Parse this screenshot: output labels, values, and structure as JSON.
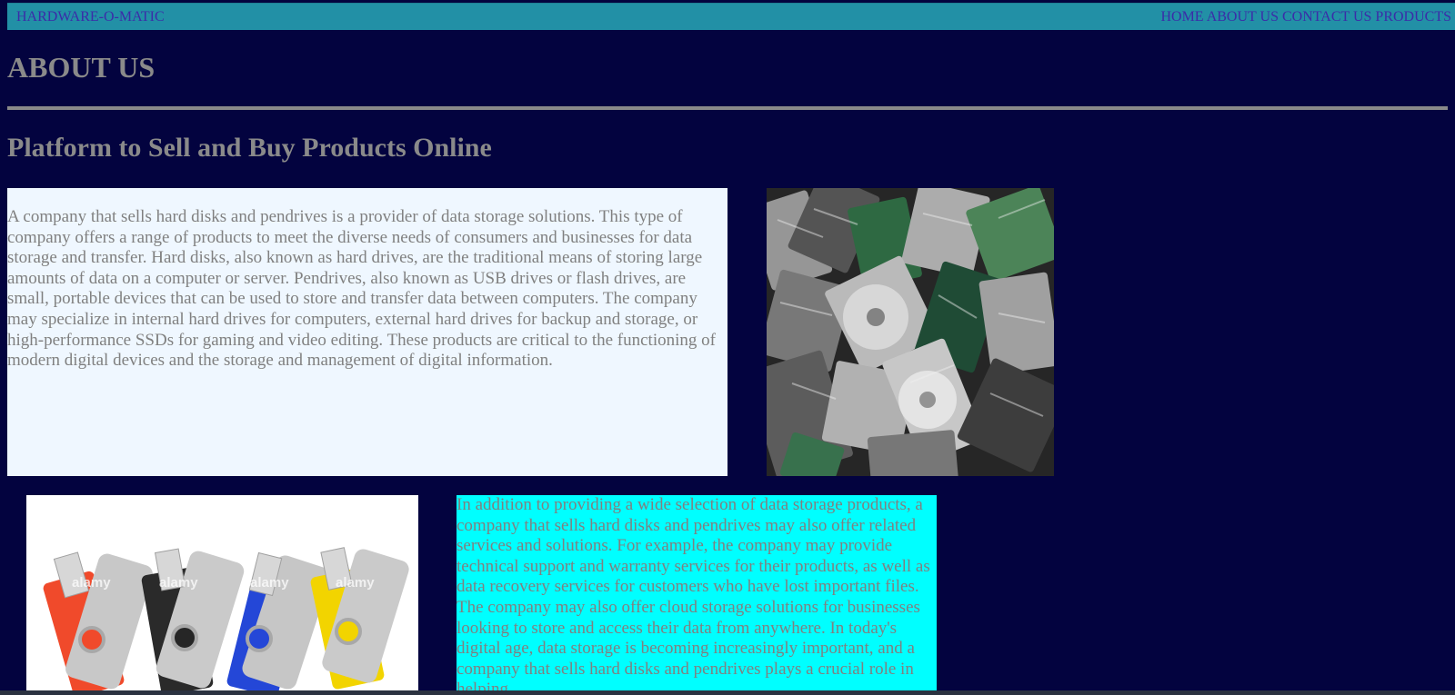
{
  "navbar": {
    "brand": "HARDWARE-O-MATIC",
    "links": [
      "HOME",
      "ABOUT US",
      "CONTACT US",
      "PRODUCTS"
    ]
  },
  "page_title": "ABOUT US",
  "section_title": "Platform to Sell and Buy Products Online",
  "paragraph_1": "A company that sells hard disks and pendrives is a provider of data storage solutions. This type of company offers a range of products to meet the diverse needs of consumers and businesses for data storage and transfer. Hard disks, also known as hard drives, are the traditional means of storing large amounts of data on a computer or server. Pendrives, also known as USB drives or flash drives, are small, portable devices that can be used to store and transfer data between computers. The company may specialize in internal hard drives for computers, external hard drives for backup and storage, or high-performance SSDs for gaming and video editing. These products are critical to the functioning of modern digital devices and the storage and management of digital information.",
  "paragraph_2": "In addition to providing a wide selection of data storage products, a company that sells hard disks and pendrives may also offer related services and solutions. For example, the company may provide technical support and warranty services for their products, as well as data recovery services for customers who have lost important files. The company may also offer cloud storage solutions for businesses looking to store and access their data from anywhere. In today's digital age, data storage is becoming increasingly important, and a company that sells hard disks and pendrives plays a crucial role in helping",
  "colors": {
    "background": "#03033f",
    "navbar": "#2290a6",
    "nav_text": "#3b2ca8",
    "heading_text": "#8a8a8a",
    "panel_1": "#eff7ff",
    "panel_2": "#00ffff"
  },
  "images": {
    "hdd_watermark": "",
    "usb_watermark": "alamy"
  }
}
